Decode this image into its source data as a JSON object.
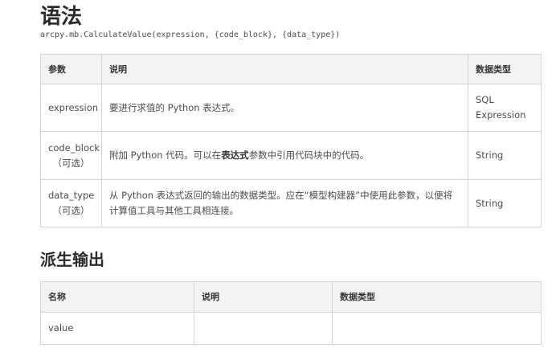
{
  "syntax": {
    "title": "语法",
    "signature": "arcpy.mb.CalculateValue(expression, {code_block}, {data_type})"
  },
  "params_table": {
    "headers": [
      "参数",
      "说明",
      "数据类型"
    ],
    "rows": [
      {
        "name": "expression",
        "optional": "",
        "description": "要进行求值的 Python 表达式。",
        "type_line1": "SQL",
        "type_line2": "Expression"
      },
      {
        "name": "code_block",
        "optional": "（可选）",
        "description_before": "附加 Python 代码。可以在",
        "description_bold": "表达式",
        "description_after": "参数中引用代码块中的代码。",
        "type": "String"
      },
      {
        "name": "data_type",
        "optional": "（可选）",
        "description": "从 Python 表达式返回的输出的数据类型。应在“模型构建器”中使用此参数，以便将计算值工具与其他工具相连接。",
        "type": "String"
      }
    ]
  },
  "derived": {
    "title": "派生输出",
    "headers": [
      "名称",
      "说明",
      "数据类型"
    ],
    "rows": [
      {
        "name": "value",
        "description": "",
        "type": ""
      }
    ]
  }
}
